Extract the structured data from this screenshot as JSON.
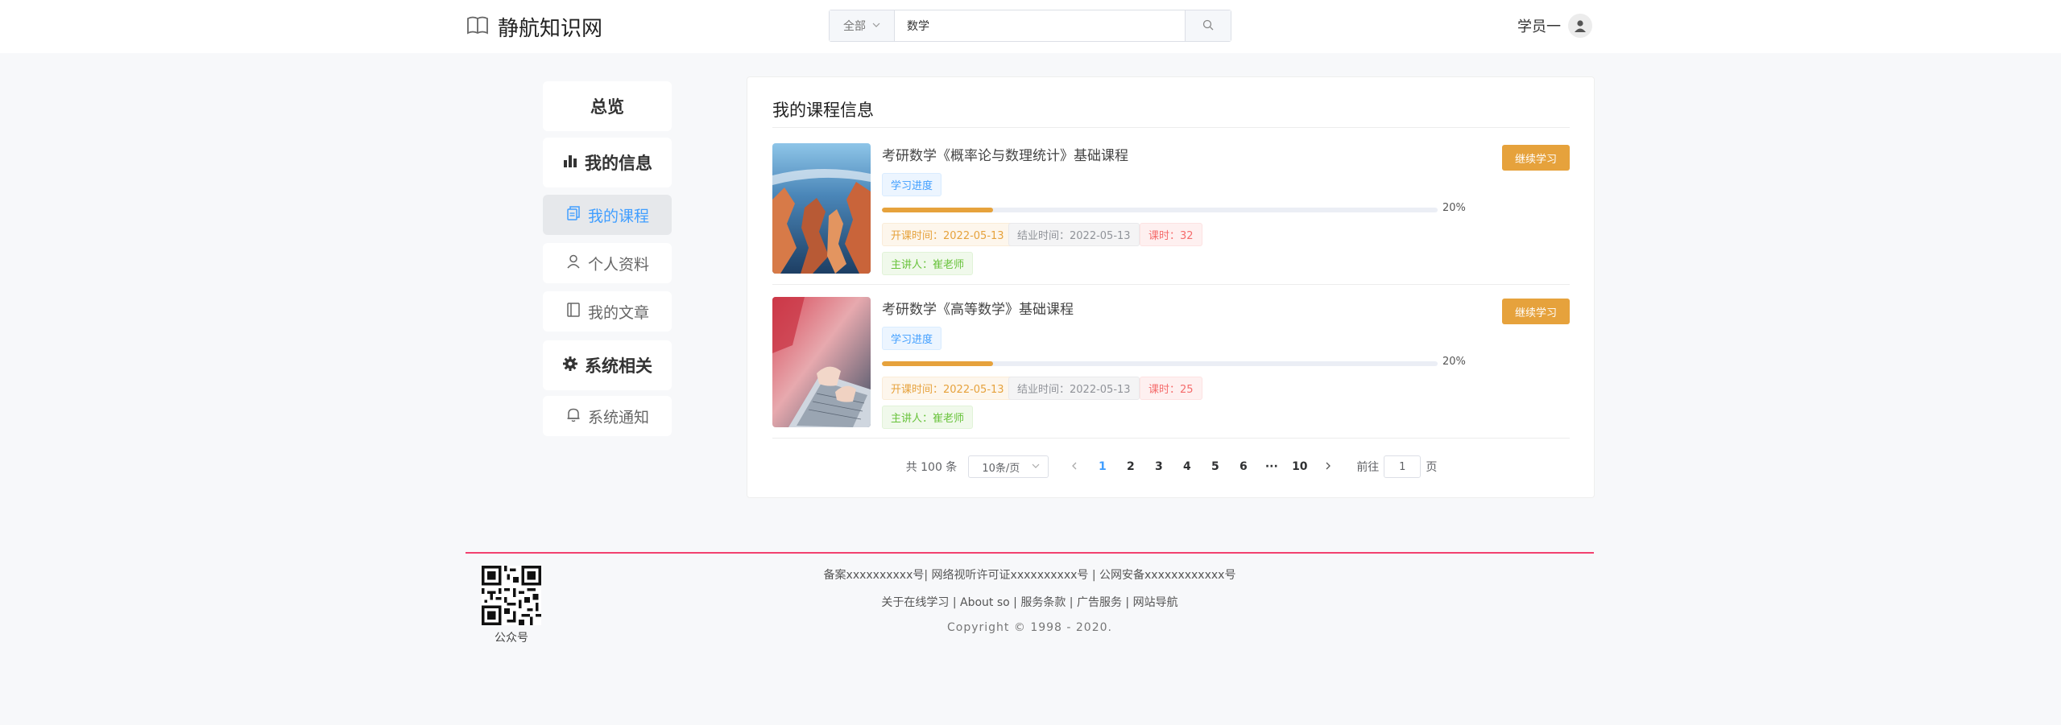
{
  "header": {
    "site_name": "静航知识网",
    "search_scope": "全部",
    "search_value": "数学",
    "user_name": "学员一"
  },
  "sidebar": {
    "items": [
      {
        "label": "总览",
        "icon": "none"
      },
      {
        "label": "我的信息",
        "icon": "bar-chart-icon"
      },
      {
        "label": "我的课程",
        "icon": "copy-document-icon",
        "active": true
      },
      {
        "label": "个人资料",
        "icon": "user-icon"
      },
      {
        "label": "我的文章",
        "icon": "notebook-icon"
      },
      {
        "label": "系统相关",
        "icon": "gear-icon"
      },
      {
        "label": "系统通知",
        "icon": "bell-icon"
      }
    ]
  },
  "main": {
    "title": "我的课程信息",
    "courses": [
      {
        "name": "考研数学《概率论与数理统计》基础课程",
        "progress_label": "学习进度",
        "progress": 20,
        "progress_text": "20%",
        "start": "开课时间：2022-05-13",
        "end": "结业时间：2022-05-13",
        "hours": "课时：32",
        "teacher": "主讲人：崔老师",
        "button": "继续学习"
      },
      {
        "name": "考研数学《高等数学》基础课程",
        "progress_label": "学习进度",
        "progress": 20,
        "progress_text": "20%",
        "start": "开课时间：2022-05-13",
        "end": "结业时间：2022-05-13",
        "hours": "课时：25",
        "teacher": "主讲人：崔老师",
        "button": "继续学习"
      }
    ],
    "pager": {
      "total": "共 100 条",
      "page_size": "10条/页",
      "pages": [
        "1",
        "2",
        "3",
        "4",
        "5",
        "6",
        "···",
        "10"
      ],
      "current": "1",
      "goto_label": "前往",
      "goto_value": "1",
      "page_unit": "页"
    }
  },
  "footer": {
    "qr_label": "公众号",
    "line1": "备案xxxxxxxxxx号| 网络视听许可证xxxxxxxxxx号 | 公网安备xxxxxxxxxxxx号",
    "line2": "关于在线学习 | About so | 服务条款 | 广告服务 | 网站导航",
    "copyright": "Copyright © 1998 - 2020."
  },
  "colors": {
    "accent": "#409eff",
    "warning": "#e6a23c",
    "footer_rule": "#f2416f"
  }
}
